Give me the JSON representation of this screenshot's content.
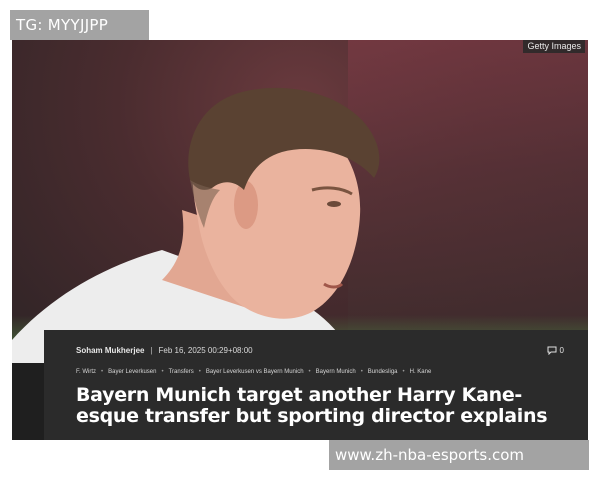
{
  "watermarks": {
    "top": "TG: MYYJJPP",
    "bottom": "www.zh-nba-esports.com"
  },
  "photo": {
    "credit": "Getty Images"
  },
  "article": {
    "author": "Soham Mukherjee",
    "separator": "|",
    "date": "Feb 16, 2025 00:29+08:00",
    "comment_count": "0",
    "tags": [
      "F. Wirtz",
      "Bayer Leverkusen",
      "Transfers",
      "Bayer Leverkusen vs Bayern Munich",
      "Bayern Munich",
      "Bundesliga",
      "H. Kane"
    ],
    "headline": "Bayern Munich target another Harry Kane-esque transfer but sporting director explains"
  },
  "colors": {
    "watermark_bg": "#a3a3a3",
    "card_bg": "#2b2b2b",
    "headline_text": "#ffffff"
  },
  "icons": {
    "comment": "comment-icon",
    "photo": "player-photo"
  }
}
